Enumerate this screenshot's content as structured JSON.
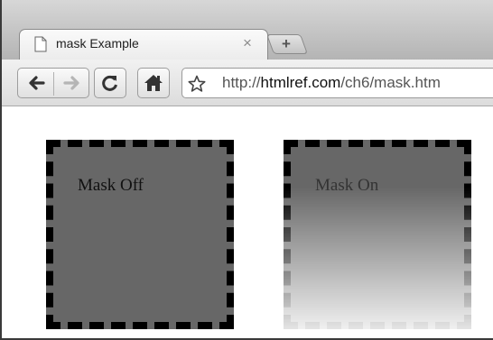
{
  "browser": {
    "tab": {
      "title": "mask Example",
      "close_glyph": "×",
      "icon": "page-icon"
    },
    "new_tab_glyph": "+",
    "toolbar": {
      "back_icon": "back-arrow-icon",
      "forward_icon": "forward-arrow-icon",
      "reload_icon": "reload-icon",
      "home_icon": "home-icon",
      "bookmark_icon": "star-icon"
    },
    "address": {
      "scheme": "http://",
      "host": "htmlref.com",
      "path": "/ch6/mask.htm"
    }
  },
  "content": {
    "box_off": {
      "label": "Mask Off"
    },
    "box_on": {
      "label": "Mask On"
    }
  },
  "colors": {
    "box_fill": "#676767",
    "box_border": "#000000"
  }
}
